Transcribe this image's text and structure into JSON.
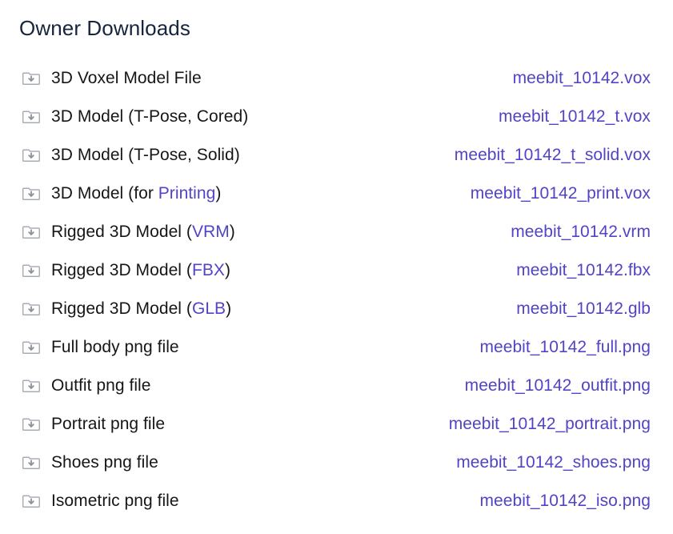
{
  "header": {
    "title": "Owner Downloads"
  },
  "colors": {
    "link": "#5244c6",
    "label": "#16161a",
    "title": "#16253c",
    "icon": "#a9aeb6",
    "background": "#ffffff"
  },
  "icons": {
    "download_folder": "folder-download-icon"
  },
  "downloads": {
    "rows": [
      {
        "label_pre": "3D Voxel Model File",
        "label_link": "",
        "label_post": "",
        "file": "meebit_10142.vox"
      },
      {
        "label_pre": "3D Model (T-Pose, Cored)",
        "label_link": "",
        "label_post": "",
        "file": "meebit_10142_t.vox"
      },
      {
        "label_pre": "3D Model (T-Pose, Solid)",
        "label_link": "",
        "label_post": "",
        "file": "meebit_10142_t_solid.vox"
      },
      {
        "label_pre": "3D Model (for ",
        "label_link": "Printing",
        "label_post": ")",
        "file": "meebit_10142_print.vox"
      },
      {
        "label_pre": "Rigged 3D Model (",
        "label_link": "VRM",
        "label_post": ")",
        "file": "meebit_10142.vrm"
      },
      {
        "label_pre": "Rigged 3D Model (",
        "label_link": "FBX",
        "label_post": ")",
        "file": "meebit_10142.fbx"
      },
      {
        "label_pre": "Rigged 3D Model (",
        "label_link": "GLB",
        "label_post": ")",
        "file": "meebit_10142.glb"
      },
      {
        "label_pre": "Full body png file",
        "label_link": "",
        "label_post": "",
        "file": "meebit_10142_full.png"
      },
      {
        "label_pre": "Outfit png file",
        "label_link": "",
        "label_post": "",
        "file": "meebit_10142_outfit.png"
      },
      {
        "label_pre": "Portrait png file",
        "label_link": "",
        "label_post": "",
        "file": "meebit_10142_portrait.png"
      },
      {
        "label_pre": "Shoes png file",
        "label_link": "",
        "label_post": "",
        "file": "meebit_10142_shoes.png"
      },
      {
        "label_pre": "Isometric png file",
        "label_link": "",
        "label_post": "",
        "file": "meebit_10142_iso.png"
      }
    ]
  }
}
